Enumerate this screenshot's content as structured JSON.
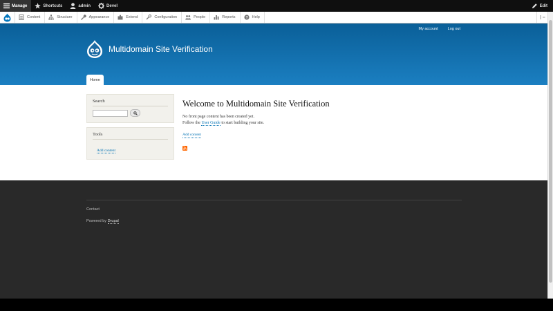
{
  "toolbar": {
    "manage": "Manage",
    "shortcuts": "Shortcuts",
    "user": "admin",
    "devel": "Devel",
    "edit": "Edit"
  },
  "tray": {
    "items": [
      {
        "label": "Content",
        "icon": "content-icon"
      },
      {
        "label": "Structure",
        "icon": "structure-icon"
      },
      {
        "label": "Appearance",
        "icon": "appearance-icon"
      },
      {
        "label": "Extend",
        "icon": "extend-icon"
      },
      {
        "label": "Configuration",
        "icon": "configuration-icon"
      },
      {
        "label": "People",
        "icon": "people-icon"
      },
      {
        "label": "Reports",
        "icon": "reports-icon"
      },
      {
        "label": "Help",
        "icon": "help-icon"
      }
    ]
  },
  "header": {
    "site_name": "Multidomain Site Verification",
    "my_account": "My account",
    "log_out": "Log out",
    "home_tab": "Home"
  },
  "sidebar": {
    "search_title": "Search",
    "tools_title": "Tools",
    "add_content": "Add content"
  },
  "content": {
    "title": "Welcome to Multidomain Site Verification",
    "line1": "No front page content has been created yet.",
    "line2_before": "Follow the ",
    "line2_link": "User Guide",
    "line2_after": " to start building your site.",
    "add_content": "Add content"
  },
  "footer": {
    "contact": "Contact",
    "powered_by": "Powered by ",
    "drupal": "Drupal"
  },
  "colors": {
    "header_top": "#0a5f98",
    "header_bottom": "#1b7fc1",
    "link": "#0071b3",
    "footer_bg": "#292929",
    "feed": "#ff6600"
  }
}
